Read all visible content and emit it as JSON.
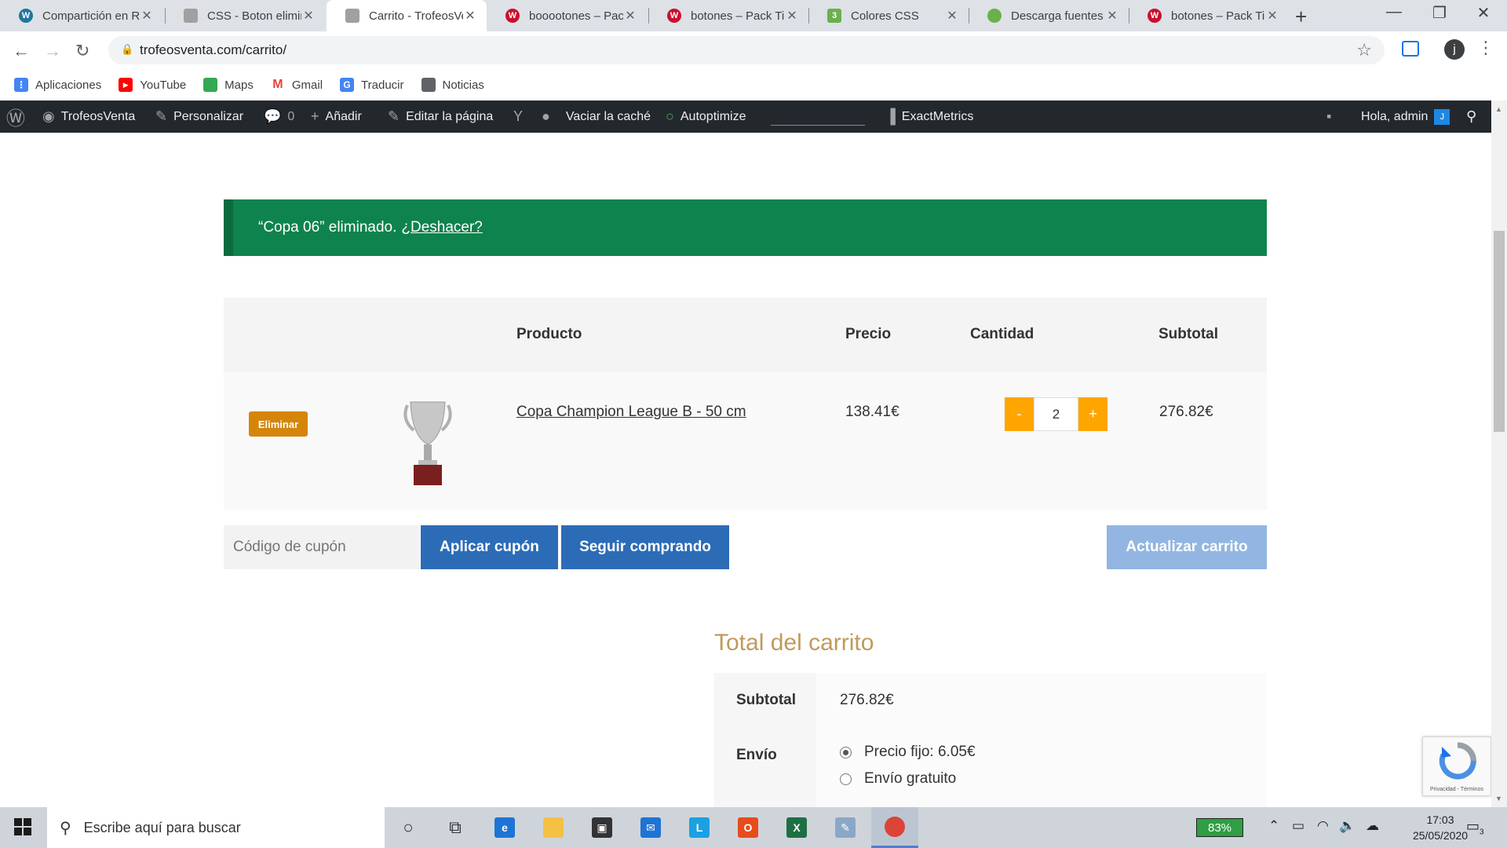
{
  "browser": {
    "tabs": [
      {
        "title": "Compartición en R",
        "fav_color": "#21759b",
        "fav_letter": "W"
      },
      {
        "title": "CSS - Boton elimin",
        "fav_color": "#a0a0a0",
        "fav_letter": ""
      },
      {
        "title": "Carrito - TrofeosVe",
        "fav_color": "#a0a0a0",
        "fav_letter": ""
      },
      {
        "title": "booootones – Pack",
        "fav_color": "#c8102e",
        "fav_letter": "W"
      },
      {
        "title": "botones – Pack Tie",
        "fav_color": "#c8102e",
        "fav_letter": "W"
      },
      {
        "title": "Colores CSS",
        "fav_color": "#6ab04c",
        "fav_letter": "3"
      },
      {
        "title": "Descarga fuentes",
        "fav_color": "#6ab04c",
        "fav_letter": ""
      },
      {
        "title": "botones – Pack Tie",
        "fav_color": "#c8102e",
        "fav_letter": "W"
      }
    ],
    "active_tab_index": 2,
    "new_tab": "+",
    "window_controls": {
      "minimize": "—",
      "maximize": "❐",
      "close": "✕"
    },
    "url": "trofeosventa.com/carrito/",
    "profile_initial": "j"
  },
  "bookmarks": [
    {
      "label": "Aplicaciones",
      "icon": "apps-grid-icon",
      "color": "#4285f4"
    },
    {
      "label": "YouTube",
      "icon": "youtube-icon",
      "color": "#ff0000"
    },
    {
      "label": "Maps",
      "icon": "maps-icon",
      "color": "#34a853"
    },
    {
      "label": "Gmail",
      "icon": "gmail-icon",
      "color": "#ea4335"
    },
    {
      "label": "Traducir",
      "icon": "translate-icon",
      "color": "#4285f4"
    },
    {
      "label": "Noticias",
      "icon": "news-icon",
      "color": "#5f6368"
    }
  ],
  "wp_admin_bar": {
    "site_name": "TrofeosVenta",
    "customize": "Personalizar",
    "comments_count": "0",
    "add_new": "Añadir",
    "edit_page": "Editar la página",
    "clear_cache": "Vaciar la caché",
    "autoptimize": "Autoptimize",
    "exactmetrics": "ExactMetrics",
    "greeting": "Hola, admin",
    "avatar_letter": "J"
  },
  "notice": {
    "text": "“Copa 06” eliminado.",
    "undo_link": "¿Deshacer?",
    "bg_color": "#0f834d"
  },
  "cart": {
    "headers": {
      "product": "Producto",
      "price": "Precio",
      "quantity": "Cantidad",
      "subtotal": "Subtotal"
    },
    "item": {
      "remove_label": "Eliminar",
      "name": "Copa Champion League B - 50 cm",
      "price": "138.41€",
      "quantity": "2",
      "minus": "-",
      "plus": "+",
      "subtotal": "276.82€"
    },
    "coupon_placeholder": "Código de cupón",
    "apply_coupon": "Aplicar cupón",
    "continue_shopping": "Seguir comprando",
    "update_cart": "Actualizar carrito",
    "accent_orange": "#ffa500",
    "button_blue": "#2c6cb7"
  },
  "totals": {
    "title": "Total del carrito",
    "subtotal_label": "Subtotal",
    "subtotal_value": "276.82€",
    "shipping_label": "Envío",
    "shipping_options": [
      {
        "label": "Precio fijo: 6.05€",
        "selected": true
      },
      {
        "label": "Envío gratuito",
        "selected": false
      }
    ]
  },
  "recaptcha": {
    "text": "Privacidad - Términos"
  },
  "taskbar": {
    "search_placeholder": "Escribe aquí para buscar",
    "battery": "83%",
    "time": "17:03",
    "date": "25/05/2020",
    "notification_count": "3"
  }
}
